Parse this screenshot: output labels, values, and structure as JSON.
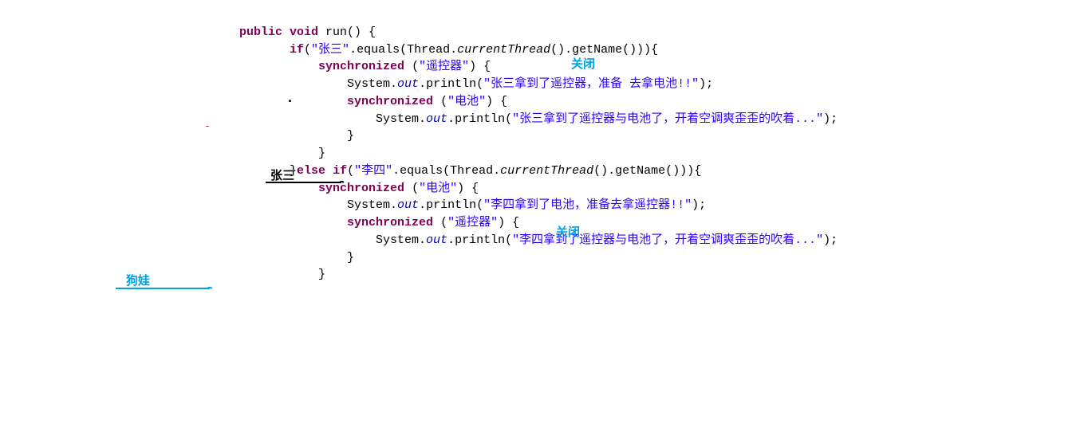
{
  "code": {
    "line1": {
      "kw1": "public",
      "kw2": "void",
      "method": " run() {"
    },
    "line2": {
      "kw": "if",
      "pre": "(",
      "str": "\"张三\"",
      "post": ".equals(Thread.",
      "italic": "currentThread",
      "post2": "().getName())){"
    },
    "line3": {
      "kw": "synchronized",
      "pre": " (",
      "str": "\"遥控器\"",
      "post": ") {"
    },
    "line4": {
      "pre": "System.",
      "out": "out",
      "mid": ".println(",
      "str": "\"张三拿到了遥控器，准备 去拿电池!!\"",
      "post": ");"
    },
    "line5": {
      "kw": "synchronized",
      "pre": " (",
      "str": "\"电池\"",
      "post": ") {"
    },
    "line6": {
      "pre": "System.",
      "out": "out",
      "mid": ".println(",
      "str": "\"张三拿到了遥控器与电池了，开着空调爽歪歪的吹着...\"",
      "post": ");"
    },
    "line7": "}",
    "line8": "}",
    "line9": {
      "pre": "}",
      "kw1": "else",
      "kw2": "if",
      "mid": "(",
      "str": "\"李四\"",
      "post": ".equals(Thread.",
      "italic": "currentThread",
      "post2": "().getName())){"
    },
    "line10": {
      "kw": "synchronized",
      "pre": " (",
      "str": "\"电池\"",
      "post": ") {"
    },
    "line11": {
      "pre": "System.",
      "out": "out",
      "mid": ".println(",
      "str": "\"李四拿到了电池，准备去拿遥控器!!\"",
      "post": ");"
    },
    "line12": {
      "kw": "synchronized",
      "pre": " (",
      "str": "\"遥控器\"",
      "post": ") {"
    },
    "line13": {
      "pre": "System.",
      "out": "out",
      "mid": ".println(",
      "str": "\"李四拿到了遥控器与电池了，开着空调爽歪歪的吹着...\"",
      "post": ");"
    },
    "line14": "}",
    "line15": "}"
  },
  "annotations": {
    "close1": "关闭",
    "close2": "关闭",
    "zhangsan": "张三",
    "gouwa": "狗娃"
  },
  "marks": {
    "dot": ".",
    "dash": "-"
  }
}
